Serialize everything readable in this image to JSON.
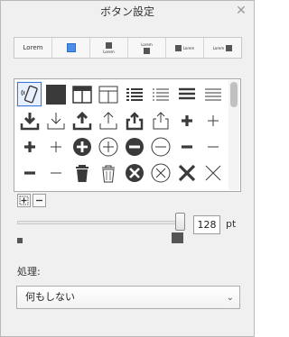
{
  "window": {
    "title": "ボタン設定",
    "close_glyph": "✕"
  },
  "styles": {
    "items": [
      {
        "label": "Lorem"
      },
      {
        "label": ""
      },
      {
        "label": "Lorem"
      },
      {
        "label": "Lorem"
      },
      {
        "label": "Lorem"
      },
      {
        "label": "Lorem"
      }
    ],
    "highlight_color": "#4b8ee8"
  },
  "icons": [
    "phone-tap-icon",
    "filled-square-icon",
    "table-header-icon",
    "table-icon",
    "bulleted-list-icon",
    "dashed-list-icon",
    "thick-lines-icon",
    "thin-lines-icon",
    "download-filled-icon",
    "download-outline-icon",
    "upload-filled-icon",
    "upload-outline-icon",
    "share-filled-icon",
    "share-outline-icon",
    "plus-bold-icon",
    "plus-thin-icon",
    "plus-bold-icon",
    "plus-thin-icon",
    "plus-circle-filled-icon",
    "plus-circle-outline-icon",
    "minus-circle-filled-icon",
    "minus-circle-outline-icon",
    "minus-bold-icon",
    "minus-thin-icon",
    "minus-bold-icon",
    "minus-thin-icon",
    "trash-filled-icon",
    "trash-outline-icon",
    "x-circle-filled-icon",
    "x-circle-outline-icon",
    "x-bold-icon",
    "x-thin-icon",
    "partial-icon-1",
    "partial-icon-2",
    "partial-icon-3",
    "partial-icon-4",
    "partial-icon-5",
    "partial-icon-6",
    "partial-icon-7",
    "partial-icon-8"
  ],
  "selected_icon_index": 0,
  "grid_buttons": [
    {
      "icon": "add-frame-icon"
    },
    {
      "icon": "minus-icon"
    }
  ],
  "size": {
    "value": "128",
    "unit": "pt",
    "slider_fraction": 1.0
  },
  "action": {
    "label": "処理:",
    "selected": "何もしない"
  }
}
